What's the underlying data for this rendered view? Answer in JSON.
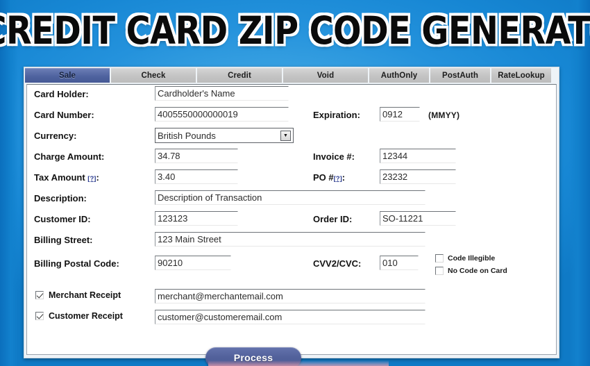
{
  "page": {
    "title": "CREDIT CARD ZIP CODE GENERATOR",
    "background_color": "#1787d4",
    "accent_color": "#4f639f"
  },
  "tabs": [
    {
      "label": "Sale",
      "active": true
    },
    {
      "label": "Check",
      "active": false
    },
    {
      "label": "Credit",
      "active": false
    },
    {
      "label": "Void",
      "active": false
    },
    {
      "label": "AuthOnly",
      "active": false
    },
    {
      "label": "PostAuth",
      "active": false
    },
    {
      "label": "RateLookup",
      "active": false
    }
  ],
  "form": {
    "card_holder": {
      "label": "Card Holder:",
      "value": "Cardholder's Name"
    },
    "card_number": {
      "label": "Card Number:",
      "value": "4005550000000019"
    },
    "expiration": {
      "label": "Expiration:",
      "value": "0912",
      "hint": "(MMYY)"
    },
    "currency": {
      "label": "Currency:",
      "value": "British Pounds",
      "icon": "chevron-down-icon"
    },
    "charge_amount": {
      "label": "Charge Amount:",
      "value": "34.78"
    },
    "invoice_number": {
      "label": "Invoice #:",
      "value": "12344"
    },
    "tax_amount": {
      "label": "Tax Amount",
      "help": "[?]",
      "suffix": ":",
      "value": "3.40"
    },
    "po_number": {
      "label": "PO #",
      "help": "[?]",
      "suffix": ":",
      "value": "23232"
    },
    "description": {
      "label": "Description:",
      "value": "Description of Transaction"
    },
    "customer_id": {
      "label": "Customer ID:",
      "value": "123123"
    },
    "order_id": {
      "label": "Order ID:",
      "value": "SO-11221"
    },
    "billing_street": {
      "label": "Billing Street:",
      "value": "123 Main Street"
    },
    "billing_postal_code": {
      "label": "Billing Postal Code:",
      "value": "90210"
    },
    "cvv2": {
      "label": "CVV2/CVC:",
      "value": "010"
    },
    "code_illegible": {
      "label": "Code Illegible",
      "checked": false
    },
    "no_code_on_card": {
      "label": "No Code on Card",
      "checked": false
    },
    "merchant_receipt": {
      "label": "Merchant Receipt",
      "checked": true,
      "value": "merchant@merchantemail.com"
    },
    "customer_receipt": {
      "label": "Customer Receipt",
      "checked": true,
      "value": "customer@customeremail.com"
    },
    "submit": {
      "label": "Process"
    }
  }
}
